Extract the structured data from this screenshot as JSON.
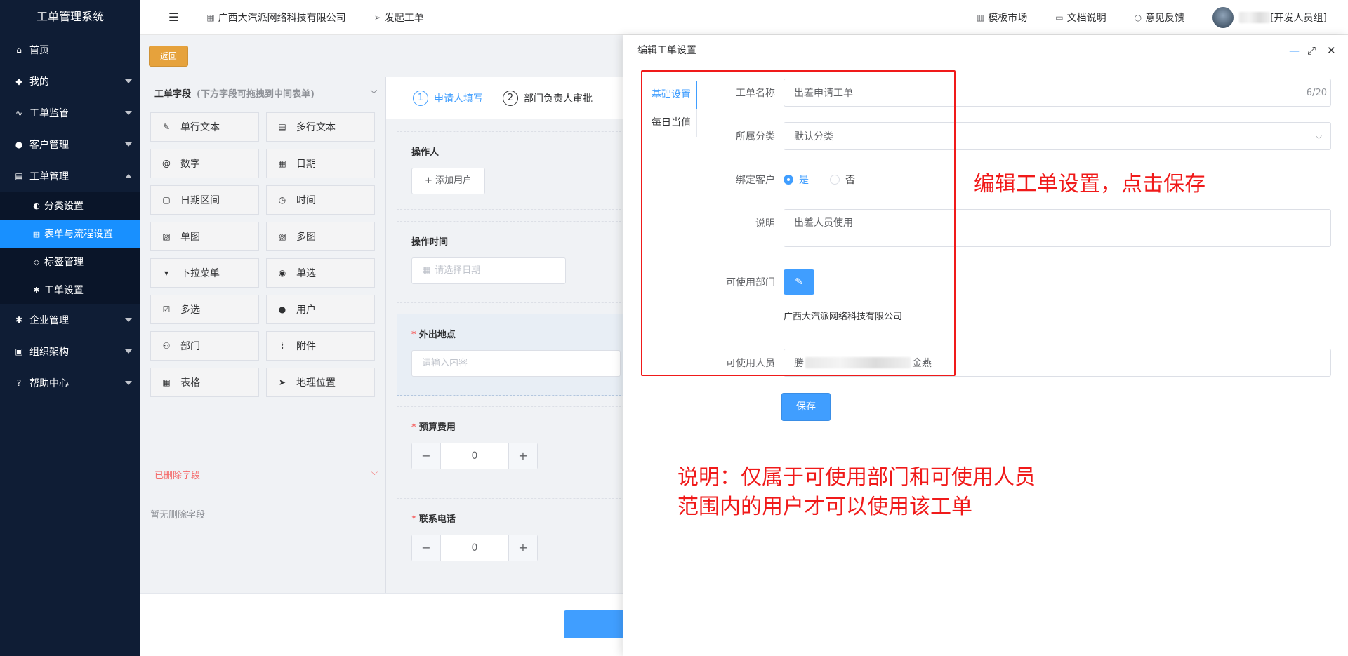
{
  "sidebar": {
    "title": "工单管理系统",
    "items": [
      {
        "label": "首页",
        "icon": "home-icon"
      },
      {
        "label": "我的",
        "icon": "layers-icon"
      },
      {
        "label": "工单监管",
        "icon": "pulse-icon"
      },
      {
        "label": "客户管理",
        "icon": "users-icon"
      },
      {
        "label": "工单管理",
        "icon": "clipboard-icon"
      }
    ],
    "subitems": [
      {
        "label": "分类设置",
        "icon": "category-icon"
      },
      {
        "label": "表单与流程设置",
        "icon": "grid-icon"
      },
      {
        "label": "标签管理",
        "icon": "tag-icon"
      },
      {
        "label": "工单设置",
        "icon": "gear-icon"
      }
    ],
    "items2": [
      {
        "label": "企业管理",
        "icon": "gear-icon"
      },
      {
        "label": "组织架构",
        "icon": "org-icon"
      },
      {
        "label": "帮助中心",
        "icon": "help-icon"
      }
    ]
  },
  "topbar": {
    "company": "广西大汽派网络科技有限公司",
    "create": "发起工单",
    "market": "模板市场",
    "docs": "文档说明",
    "feedback": "意见反馈",
    "user_role": "[开发人员组]"
  },
  "toolbar": {
    "back": "返回"
  },
  "fields_panel": {
    "title": "工单字段",
    "hint": "(下方字段可拖拽到中间表单)",
    "fields": [
      "单行文本",
      "多行文本",
      "数字",
      "日期",
      "日期区间",
      "时间",
      "单图",
      "多图",
      "下拉菜单",
      "单选",
      "多选",
      "用户",
      "部门",
      "附件",
      "表格",
      "地理位置"
    ],
    "deleted_title": "已删除字段",
    "deleted_empty": "暂无删除字段"
  },
  "form": {
    "steps": [
      {
        "num": "1",
        "label": "申请人填写"
      },
      {
        "num": "2",
        "label": "部门负责人审批"
      }
    ],
    "operator_label": "操作人",
    "add_user": "+ 添加用户",
    "time_label": "操作时间",
    "time_placeholder": "请选择日期",
    "location_label": "外出地点",
    "location_placeholder": "请输入内容",
    "budget_label": "预算费用",
    "budget_value": "0",
    "phone_label": "联系电话",
    "phone_value": "0",
    "minus": "−",
    "plus": "+"
  },
  "drawer": {
    "title": "编辑工单设置",
    "tabs": [
      "基础设置",
      "每日当值"
    ],
    "name_label": "工单名称",
    "name_value": "出差申请工单",
    "name_counter": "6/20",
    "category_label": "所属分类",
    "category_value": "默认分类",
    "bind_label": "绑定客户",
    "bind_yes": "是",
    "bind_no": "否",
    "desc_label": "说明",
    "desc_value": "出差人员使用",
    "dept_label": "可使用部门",
    "dept_value": "广西大汽派网络科技有限公司",
    "people_label": "可使用人员",
    "people_start": "勝",
    "people_end": "金燕",
    "save": "保存"
  },
  "annotations": {
    "note1": "编辑工单设置，点击保存",
    "note2_line1": "说明：仅属于可使用部门和可使用人员",
    "note2_line2": "范围内的用户才可以使用该工单"
  },
  "colors": {
    "sidebar_bg": "#0f1d35",
    "accent": "#409eff",
    "annotation_red": "#f01a1a",
    "back_button": "#e6a23c"
  }
}
